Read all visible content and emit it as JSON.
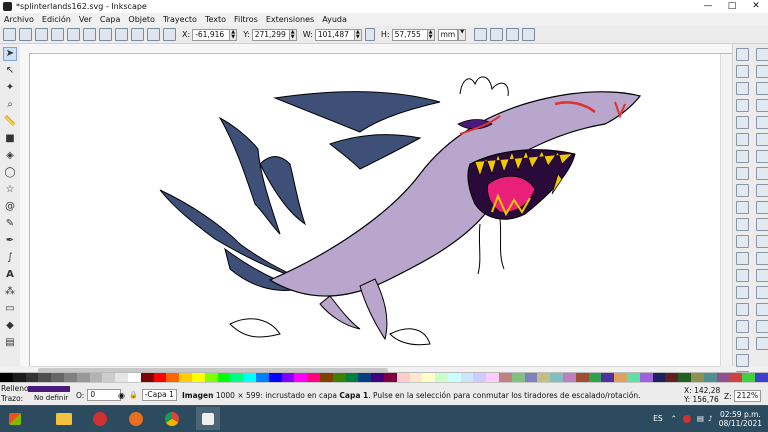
{
  "window": {
    "title": "*splinterlands162.svg - Inkscape",
    "minimize": "—",
    "maximize": "□",
    "close": "✕"
  },
  "menu": [
    "Archivo",
    "Edición",
    "Ver",
    "Capa",
    "Objeto",
    "Trayecto",
    "Texto",
    "Filtros",
    "Extensiones",
    "Ayuda"
  ],
  "toolbar": {
    "x_label": "X:",
    "x_value": "-61,916",
    "y_label": "Y:",
    "y_value": "271,299",
    "w_label": "W:",
    "w_value": "101,487",
    "h_label": "H:",
    "h_value": "57,755",
    "unit": "mm"
  },
  "left_tools": [
    "select-icon",
    "node-icon",
    "tweak-icon",
    "zoom-icon",
    "measure-icon",
    "rect-icon",
    "3dbox-icon",
    "ellipse-icon",
    "star-icon",
    "spiral-icon",
    "pencil-icon",
    "pen-icon",
    "calligraphy-icon",
    "text-icon",
    "gradient-icon",
    "mesh-icon",
    "dropper-icon",
    "paint-bucket-icon",
    "eraser-icon",
    "spray-icon"
  ],
  "palette": [
    "#000000",
    "#1a1a1a",
    "#333333",
    "#4d4d4d",
    "#666666",
    "#808080",
    "#999999",
    "#b3b3b3",
    "#cccccc",
    "#e6e6e6",
    "#ffffff",
    "#800000",
    "#ff0000",
    "#ff6600",
    "#ffcc00",
    "#ffff00",
    "#80ff00",
    "#00ff00",
    "#00ff80",
    "#00ffff",
    "#0080ff",
    "#0000ff",
    "#8000ff",
    "#ff00ff",
    "#ff0080",
    "#804000",
    "#408000",
    "#008040",
    "#004080",
    "#400080",
    "#800040",
    "#ffcccc",
    "#ffe6cc",
    "#ffffcc",
    "#ccffcc",
    "#ccffff",
    "#cce6ff",
    "#ccccff",
    "#ffccff",
    "#c08080",
    "#80c080",
    "#8080c0",
    "#c0c080",
    "#80c0c0",
    "#c080c0",
    "#a05030",
    "#30a050",
    "#5030a0",
    "#e0a060",
    "#60e0a0",
    "#a060e0",
    "#202060",
    "#602020",
    "#206020",
    "#909050",
    "#509090",
    "#905090",
    "#d04040",
    "#40d040",
    "#4040d0"
  ],
  "status": {
    "fill_label": "Relleno:",
    "stroke_label": "Trazo:",
    "stroke_value": "No definir",
    "fill_color": "#4a1a7a",
    "opacity_label": "O:",
    "opacity_value": "0",
    "layer": "-Capa 1",
    "message_bold": "Imagen",
    "message": "1000 × 599: incrustado en capa",
    "message_layer": "Capa 1",
    "message_tail": ". Pulse en la selección para conmutar los tiradores de escalado/rotación.",
    "x_label": "X:",
    "x_coord": "142,28",
    "y_label": "Y:",
    "y_coord": "156,76",
    "zoom_label": "Z:",
    "zoom_value": "212%"
  },
  "taskbar": {
    "lang": "ES",
    "time": "02:59 p.m.",
    "date": "08/11/2021"
  },
  "colors": {
    "shark_body": "#b8a6cc",
    "fins": "#3e5078",
    "mouth": "#e8207a",
    "teeth": "#f2c800",
    "scar": "#e03030",
    "eye": "#4a1a7a"
  }
}
